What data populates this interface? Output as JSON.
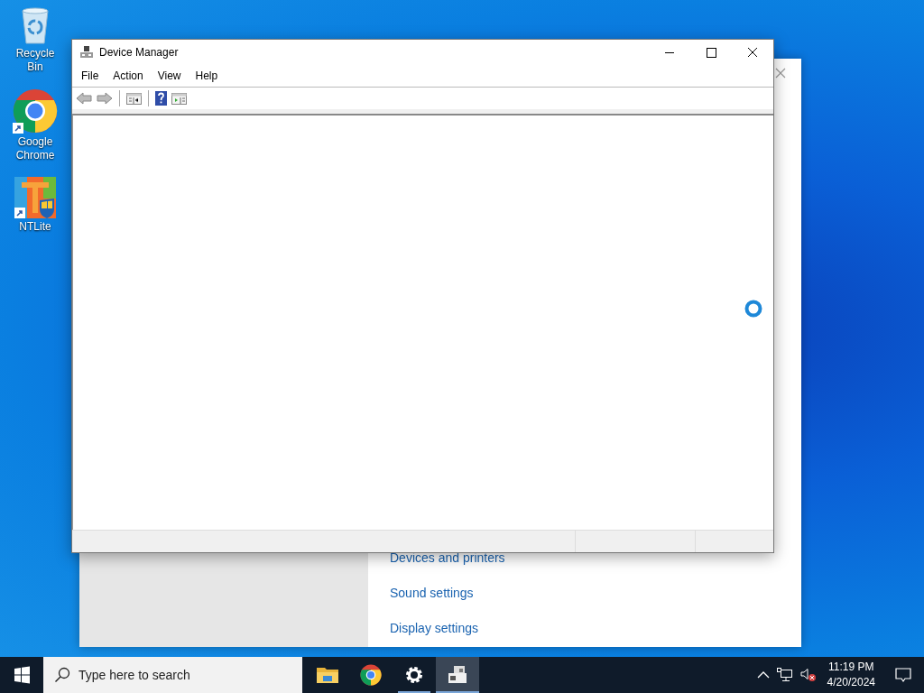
{
  "desktop_icons": [
    {
      "kind": "recycle",
      "label": "Recycle Bin"
    },
    {
      "kind": "chrome",
      "label": "Google Chrome"
    },
    {
      "kind": "ntlite",
      "label": "NTLite"
    }
  ],
  "background_window": {
    "links": [
      "Devices and printers",
      "Sound settings",
      "Display settings"
    ]
  },
  "window": {
    "title": "Device Manager",
    "menu": [
      "File",
      "Action",
      "View",
      "Help"
    ],
    "loading": true
  },
  "taskbar": {
    "search": {
      "placeholder": "Type here to search"
    },
    "apps": [
      {
        "kind": "explorer",
        "running": false,
        "selected": false
      },
      {
        "kind": "chrome",
        "running": false,
        "selected": false
      },
      {
        "kind": "settings",
        "running": true,
        "selected": false
      },
      {
        "kind": "devmgr",
        "running": true,
        "selected": true
      }
    ],
    "time": "11:19 PM",
    "date": "4/20/2024"
  }
}
